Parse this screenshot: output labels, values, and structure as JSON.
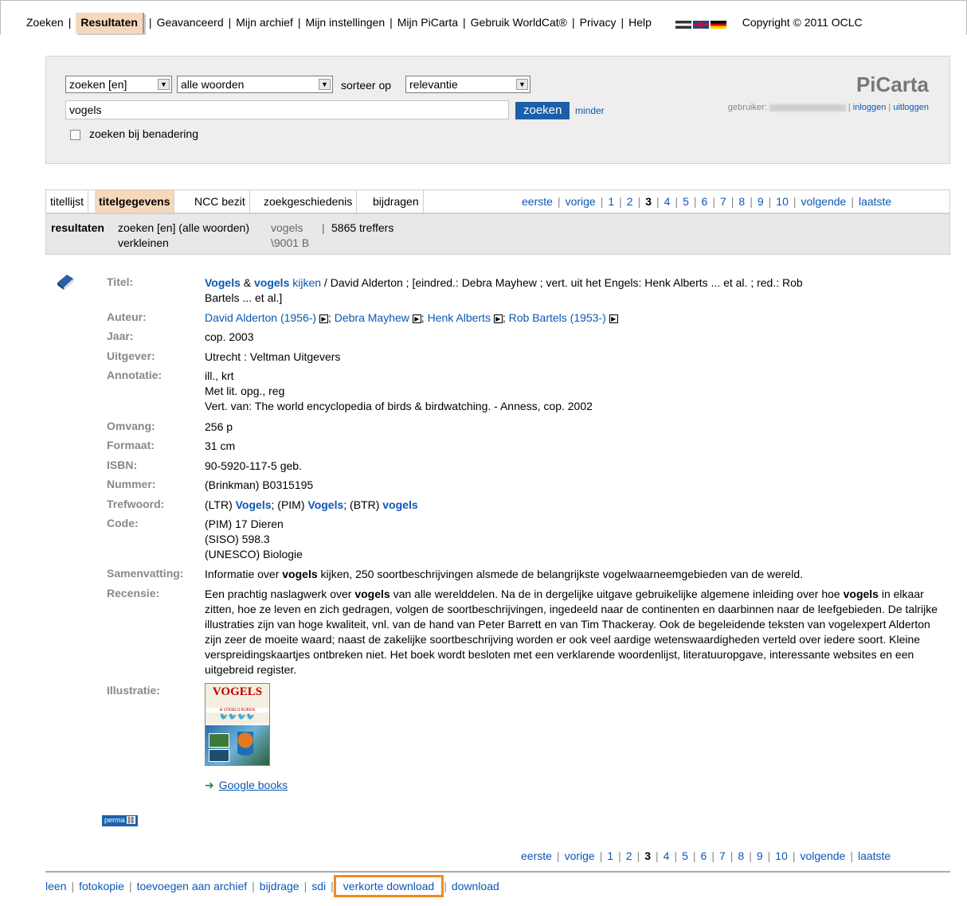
{
  "topnav": {
    "items": [
      "Zoeken",
      "Resultaten",
      "Geavanceerd",
      "Mijn archief",
      "Mijn instellingen",
      "Mijn PiCarta",
      "Gebruik WorldCat®",
      "Privacy",
      "Help"
    ],
    "copyright": "Copyright © 2011 OCLC"
  },
  "search": {
    "field_select": "zoeken [en]",
    "words_select": "alle woorden",
    "sort_label": "sorteer op",
    "sort_select": "relevantie",
    "query": "vogels",
    "submit": "zoeken",
    "less": "minder",
    "approx_label": "zoeken bij benadering",
    "brand": "PiCarta",
    "user_label": "gebruiker:",
    "login": "inloggen",
    "logout": "uitloggen"
  },
  "tabs": [
    "titellijst",
    "titelgegevens",
    "NCC bezit",
    "zoekgeschiedenis",
    "bijdragen"
  ],
  "pager": {
    "first": "eerste",
    "prev": "vorige",
    "pages": [
      "1",
      "2",
      "3",
      "4",
      "5",
      "6",
      "7",
      "8",
      "9",
      "10"
    ],
    "current": "3",
    "next": "volgende",
    "last": "laatste"
  },
  "results": {
    "label": "resultaten",
    "query_desc": "zoeken [en] (alle woorden)",
    "term": "vogels",
    "term2": "\\9001 B",
    "count": "5865 treffers",
    "reduce": "verkleinen"
  },
  "record": {
    "labels": {
      "titel": "Titel:",
      "auteur": "Auteur:",
      "jaar": "Jaar:",
      "uitgever": "Uitgever:",
      "annotatie": "Annotatie:",
      "omvang": "Omvang:",
      "formaat": "Formaat:",
      "isbn": "ISBN:",
      "nummer": "Nummer:",
      "trefwoord": "Trefwoord:",
      "code": "Code:",
      "samenvatting": "Samenvatting:",
      "recensie": "Recensie:",
      "illustratie": "Illustratie:"
    },
    "title_w1": "Vogels",
    "title_amp": " & ",
    "title_w2": "vogels",
    "title_w3": " kijken",
    "title_rest": " / David Alderton ; [eindred.: Debra Mayhew ; vert. uit het Engels: Henk Alberts ... et al. ; red.: Rob",
    "title_rest2": "Bartels ... et al.]",
    "authors": [
      "David Alderton (1956-)",
      "Debra Mayhew",
      "Henk Alberts",
      "Rob Bartels (1953-)"
    ],
    "jaar": "cop. 2003",
    "uitgever": "Utrecht : Veltman Uitgevers",
    "annotatie": [
      "ill., krt",
      "Met lit. opg., reg",
      "Vert. van: The world encyclopedia of birds & birdwatching. - Anness, cop. 2002"
    ],
    "omvang": "256 p",
    "formaat": "31 cm",
    "isbn": "90-5920-117-5 geb.",
    "nummer": "(Brinkman) B0315195",
    "trefwoord": {
      "p1": "(LTR)",
      "l1": "Vogels",
      "p2": "; (PIM)",
      "l2": "Vogels",
      "p3": "; (BTR)",
      "l3": "vogels"
    },
    "code": [
      "(PIM) 17 Dieren",
      "(SISO) 598.3",
      "(UNESCO) Biologie"
    ],
    "samenvatting_a": "Informatie over ",
    "samenvatting_b": "vogels",
    "samenvatting_c": " kijken, 250 soortbeschrijvingen alsmede de belangrijkste vogelwaarneemgebieden van de wereld.",
    "recensie_a": "Een prachtig naslagwerk over ",
    "recensie_b": "vogels",
    "recensie_c": " van alle werelddelen. Na de in dergelijke uitgave gebruikelijke algemene inleiding over hoe ",
    "recensie_d": "vogels",
    "recensie_e": " in elkaar zitten, hoe ze leven en zich gedragen, volgen de soortbeschrijvingen, ingedeeld naar de continenten en daarbinnen naar de leefgebieden. De talrijke illustraties zijn van hoge kwaliteit, vnl. van de hand van Peter Barrett en van Tim Thackeray. Ook de begeleidende teksten van vogelexpert Alderton zijn zeer de moeite waard; naast de zakelijke soortbeschrijving worden er ook veel aardige wetenswaardigheden verteld over iedere soort. Kleine verspreidingskaartjes ontbreken niet. Het boek wordt besloten met een verklarende woordenlijst, literatuuropgave, interessante websites en een uitgebreid register.",
    "cover_title": "VOGELS",
    "cover_sub": "& VOGELS KIJKEN",
    "google_books": "Google books",
    "perma": "perma"
  },
  "bottom": [
    "leen",
    "fotokopie",
    "toevoegen aan archief",
    "bijdrage",
    "sdi",
    "verkorte download",
    "download"
  ]
}
